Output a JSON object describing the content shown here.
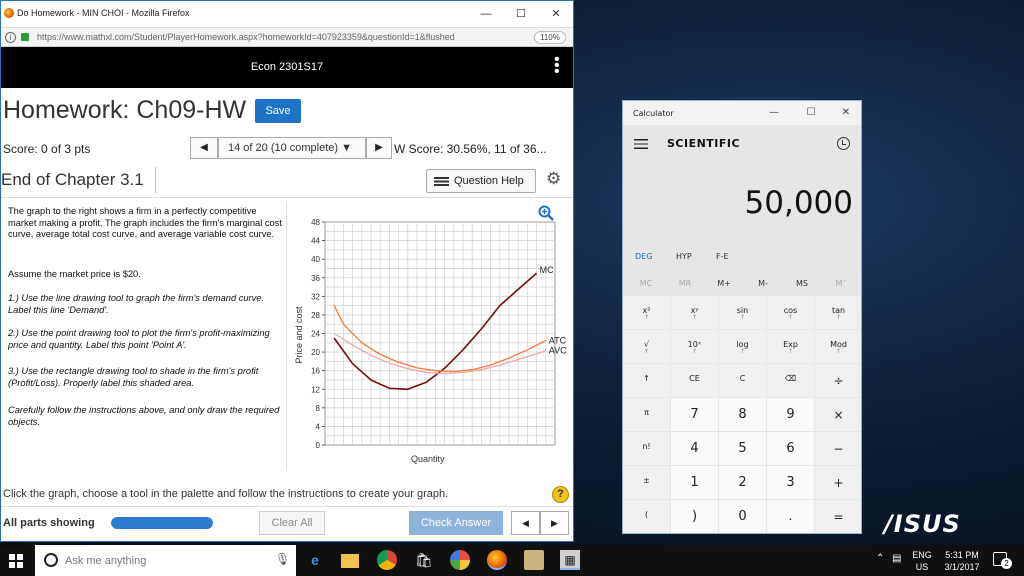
{
  "browser": {
    "window_title": "Do Homework - MIN CHOI - Mozilla Firefox",
    "url": "https://www.mathxl.com/Student/PlayerHomework.aspx?homeworkId=407923359&questionId=1&flushed",
    "zoom": "110%"
  },
  "course": {
    "name": "Econ 2301S17"
  },
  "homework": {
    "title": "Homework: Ch09-HW",
    "save_label": "Save",
    "score": "Score: 0 of 3 pts",
    "question_selector": "14 of 20 (10 complete)",
    "hw_score": "W Score: 30.56%, 11 of 36...",
    "section_title": "End of Chapter 3.1",
    "question_help_label": "Question Help"
  },
  "question": {
    "intro": "The graph to the right shows a firm in a perfectly competitive market making a profit.  The graph includes the firm's marginal cost curve, average total cost curve, and average variable cost curve.",
    "price_note": "Assume the market price is $20.",
    "step1": "1.) Use the line drawing tool to graph the firm's demand curve. Label this line 'Demand'.",
    "step2": "2.) Use the point drawing tool to plot the firm's profit-maximizing price and quantity. Label this point 'Point A'.",
    "step3": "3.) Use the rectangle drawing tool to shade in the firm's profit (Profit/Loss). Properly label this shaded area.",
    "caution": "Carefully follow the instructions above, and only draw the required objects."
  },
  "footer": {
    "instruction": "Click the graph, choose a tool in the palette and follow the instructions to create your graph.",
    "help_symbol": "?",
    "parts_label": "All parts showing",
    "parts_progress": 1.0,
    "clear_all": "Clear All",
    "check_answer": "Check Answer"
  },
  "chart_data": {
    "type": "line",
    "xlabel": "Quantity",
    "ylabel": "Price and cost",
    "ylim": [
      0,
      48
    ],
    "yticks": [
      0,
      4,
      8,
      12,
      16,
      20,
      24,
      28,
      32,
      36,
      40,
      44,
      48
    ],
    "xlim": [
      0,
      25
    ],
    "grid": true,
    "series": [
      {
        "name": "MC",
        "color": "#7a0c0c",
        "x": [
          1,
          3,
          5,
          7,
          9,
          11,
          13,
          15,
          17,
          19,
          21,
          23
        ],
        "y": [
          23,
          17.5,
          14,
          12.2,
          12,
          13.5,
          16.5,
          20.5,
          25,
          30,
          33.5,
          37
        ]
      },
      {
        "name": "ATC",
        "color": "#f07b3a",
        "x": [
          1,
          2,
          4,
          6,
          8,
          10,
          12,
          14,
          16,
          18,
          20,
          22,
          24
        ],
        "y": [
          30,
          26,
          22,
          19.5,
          17.8,
          16.6,
          16,
          15.8,
          16.2,
          17.2,
          18.7,
          20.5,
          22.5
        ]
      },
      {
        "name": "AVC",
        "color": "#f2a8a0",
        "x": [
          1,
          3,
          5,
          7,
          9,
          11,
          13,
          15,
          17,
          19,
          21,
          23,
          24
        ],
        "y": [
          24,
          21.5,
          19.3,
          17.6,
          16.4,
          15.6,
          15.4,
          15.6,
          16.2,
          17.2,
          18.4,
          19.6,
          20.3
        ]
      }
    ]
  },
  "calculator": {
    "title": "Calculator",
    "mode": "SCIENTIFIC",
    "display": "50,000",
    "angle_modes": [
      "DEG",
      "HYP",
      "F-E"
    ],
    "memory_keys": [
      "MC",
      "MR",
      "M+",
      "M-",
      "MS",
      "M˅"
    ],
    "rows": [
      [
        "x²",
        "xʸ",
        "sin",
        "cos",
        "tan"
      ],
      [
        "√",
        "10ˣ",
        "log",
        "Exp",
        "Mod"
      ],
      [
        "↑",
        "CE",
        "C",
        "⌫",
        "÷"
      ],
      [
        "π",
        "7",
        "8",
        "9",
        "×"
      ],
      [
        "n!",
        "4",
        "5",
        "6",
        "−"
      ],
      [
        "±",
        "1",
        "2",
        "3",
        "+"
      ],
      [
        "(",
        ")",
        "0",
        ".",
        "="
      ]
    ]
  },
  "desktop": {
    "brand": "/ISUS"
  },
  "taskbar": {
    "search_placeholder": "Ask me anything",
    "language": "ENG",
    "region": "US",
    "time": "5:31 PM",
    "date": "3/1/2017",
    "notification_count": "2"
  },
  "colors": {
    "accent": "#1e73c6",
    "check_answer": "#8fb4da",
    "mc": "#7a0c0c",
    "atc": "#f07b3a",
    "avc": "#f2a8a0"
  }
}
